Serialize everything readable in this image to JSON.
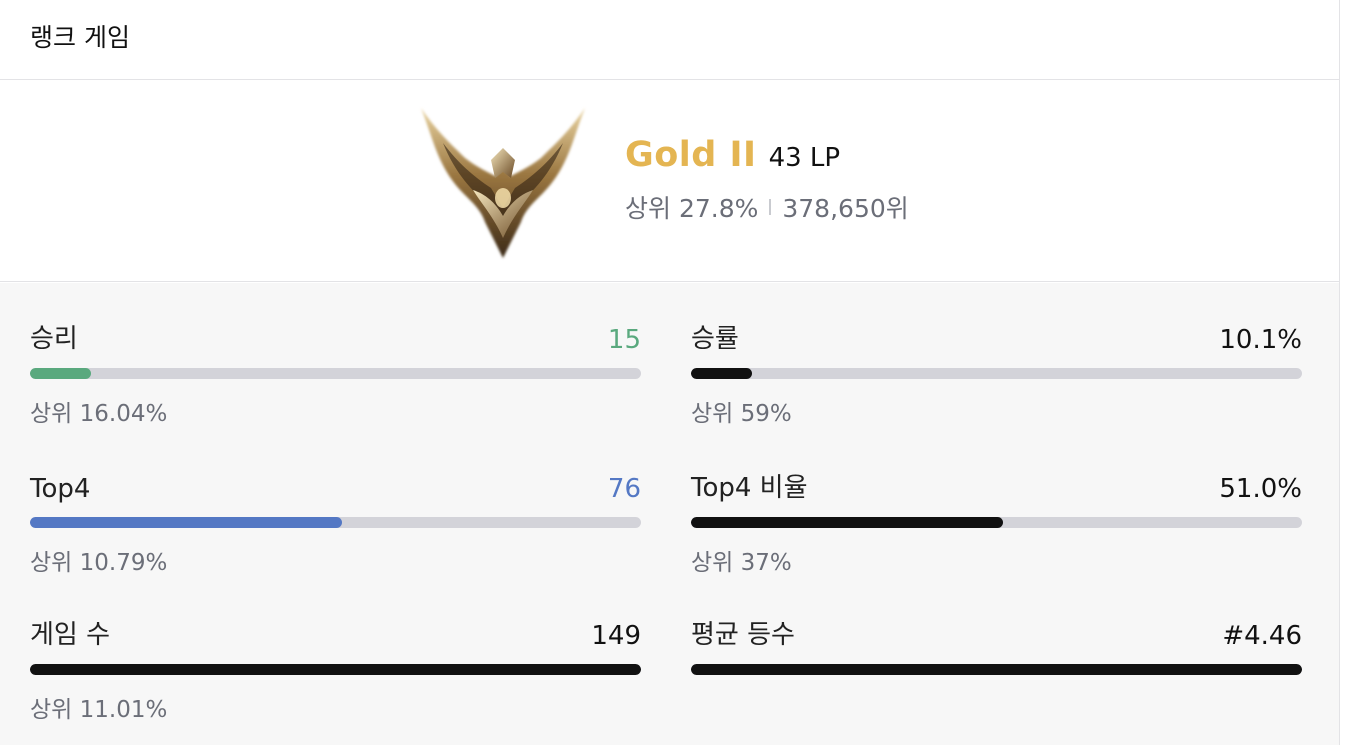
{
  "header": {
    "title": "랭크 게임"
  },
  "rank": {
    "tier": "Gold II",
    "lp": "43 LP",
    "top_percent": "상위 27.8%",
    "position": "378,650위",
    "tier_color": "#e4b552"
  },
  "stats": {
    "wins": {
      "label": "승리",
      "value": "15",
      "sub": "상위 16.04%",
      "fill_fraction": 0.1,
      "color": "#5aa97e"
    },
    "win_rate": {
      "label": "승률",
      "value": "10.1%",
      "sub": "상위 59%",
      "fill_fraction": 0.1,
      "color": "#111111"
    },
    "top4": {
      "label": "Top4",
      "value": "76",
      "sub": "상위 10.79%",
      "fill_fraction": 0.51,
      "color": "#5478c4"
    },
    "top4_rate": {
      "label": "Top4 비율",
      "value": "51.0%",
      "sub": "상위 37%",
      "fill_fraction": 0.51,
      "color": "#111111"
    },
    "games": {
      "label": "게임 수",
      "value": "149",
      "sub": "상위 11.01%",
      "fill_fraction": 1.0,
      "color": "#111111"
    },
    "avg_place": {
      "label": "평균 등수",
      "value": "#4.46",
      "fill_fraction": 1.0,
      "color": "#111111"
    }
  }
}
